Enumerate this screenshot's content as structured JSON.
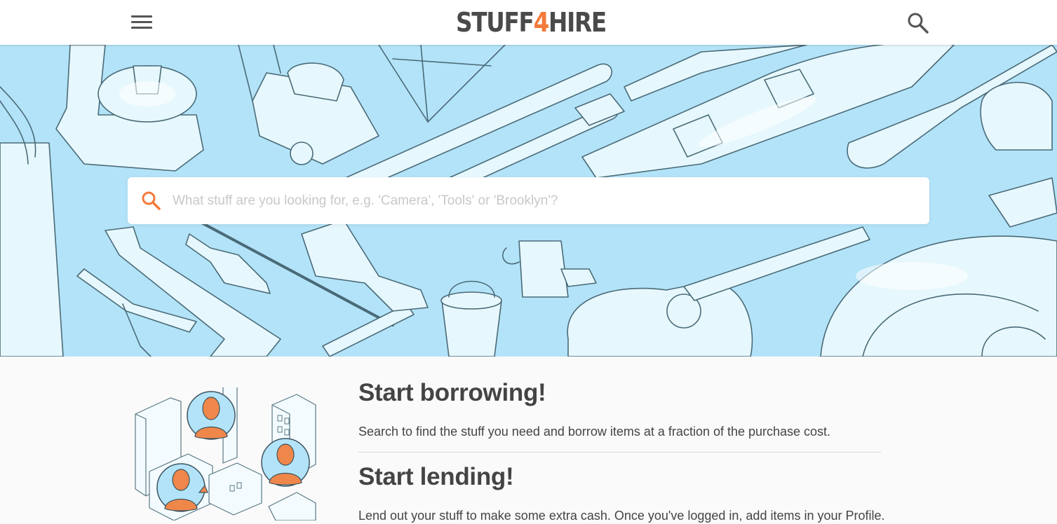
{
  "header": {
    "logo_pre": "STUFF",
    "logo_accent": "4",
    "logo_post": "HIRE",
    "menu_icon": "hamburger-menu-icon",
    "search_icon": "search-icon"
  },
  "hero": {
    "search": {
      "placeholder": "What stuff are you looking for, e.g. 'Camera', 'Tools' or 'Brooklyn'?",
      "value": ""
    }
  },
  "sections": [
    {
      "title": "Start borrowing!",
      "text": "Search to find the stuff you need and borrow items at a fraction of the purchase cost."
    },
    {
      "title": "Start lending!",
      "text": "Lend out your stuff to make some extra cash. Once you've logged in, add items in your Profile."
    }
  ],
  "colors": {
    "accent": "#f47a3a",
    "hero_bg": "#b3e3f8",
    "text": "#444444"
  }
}
